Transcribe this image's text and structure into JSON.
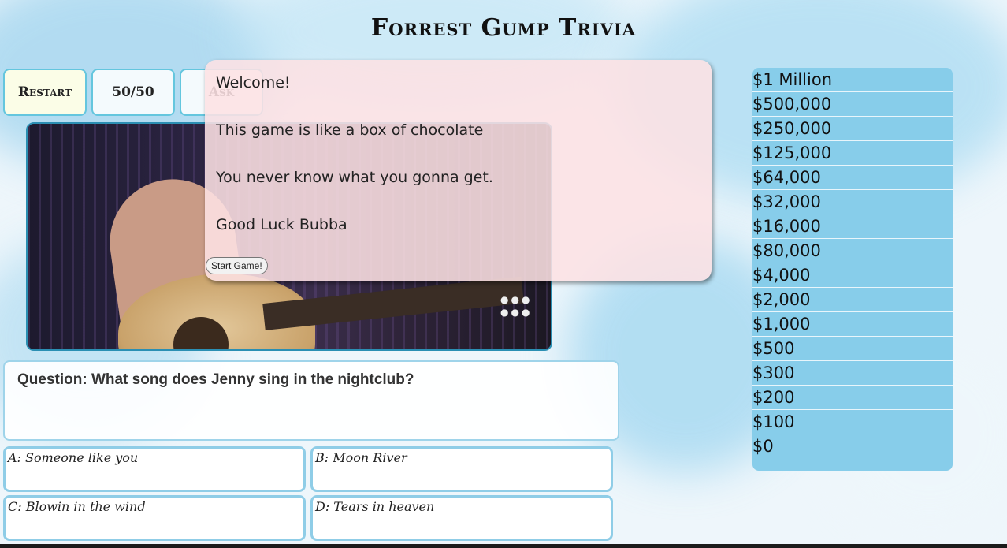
{
  "title": "Forrest Gump Trivia",
  "toolbar": {
    "restart_label": "Restart",
    "fifty_label": "50/50",
    "ask_label": "Ask"
  },
  "modal": {
    "line1": "Welcome!",
    "line2": "This game is like a box of chocolate",
    "line3": "You never know what you gonna get.",
    "line4": "Good Luck Bubba",
    "start_label": "Start Game!"
  },
  "question": {
    "text": "Question: What song does Jenny sing in the nightclub?"
  },
  "answers": [
    {
      "label": "A: Someone like you"
    },
    {
      "label": "B: Moon River"
    },
    {
      "label": "C: Blowin in the wind"
    },
    {
      "label": "D: Tears in heaven"
    }
  ],
  "prize_ladder": [
    "$1 Million",
    "$500,000",
    "$250,000",
    "$125,000",
    "$64,000",
    "$32,000",
    "$16,000",
    "$80,000",
    "$4,000",
    "$2,000",
    "$1,000",
    "$500",
    "$300",
    "$200",
    "$100",
    "$0"
  ],
  "colors": {
    "ladder_bg": "#87cdea",
    "border_accent": "#8fcde7",
    "modal_bg": "#fde1e4"
  }
}
